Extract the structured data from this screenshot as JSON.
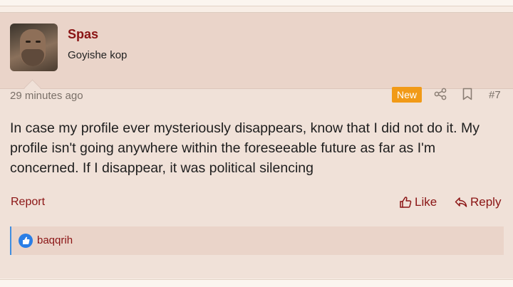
{
  "post": {
    "username": "Spas",
    "user_title": "Goyishe kop",
    "date": "29 minutes ago",
    "new_badge": "New",
    "post_number": "#7",
    "message": "In case my profile ever mysteriously disappears, know that I did not do it. My profile isn't going anywhere within the foreseeable future as far as I'm concerned. If I disappear, it was political silencing",
    "actions": {
      "report": "Report",
      "like": "Like",
      "reply": "Reply"
    },
    "reactions": {
      "user": "baqqrih",
      "icon": "thumbs-up-icon"
    }
  },
  "colors": {
    "accent": "#8a1414",
    "badge": "#f19a17",
    "reaction": "#2a7ee6"
  }
}
